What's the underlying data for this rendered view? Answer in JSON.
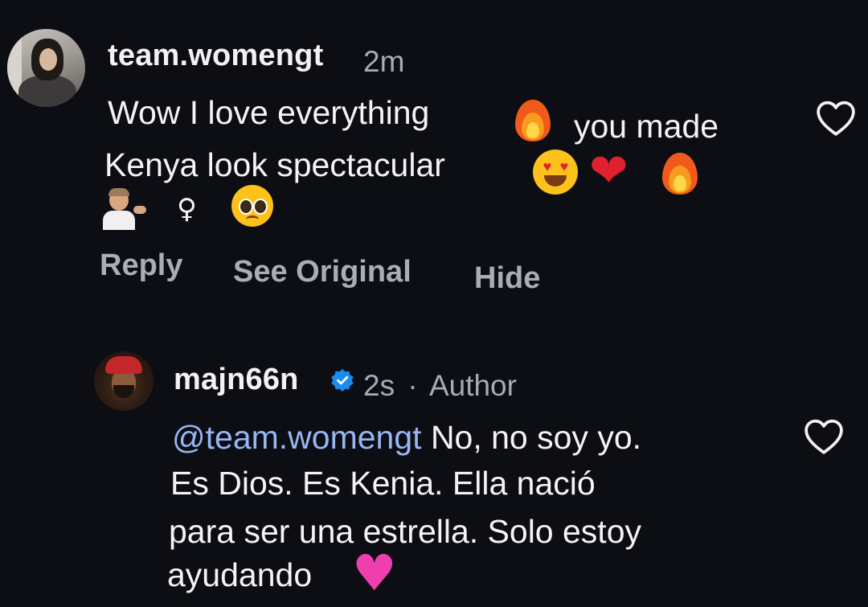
{
  "comments": [
    {
      "username": "team.womengt",
      "time": "2m",
      "text_lines": [
        "Wow I love everything",
        "you made",
        "Kenya look spectacular"
      ],
      "emojis": [
        "fire",
        "smiling-face-with-heart-eyes",
        "red-heart",
        "fire",
        "person-tipping-hand",
        "female-sign",
        "pleading-face"
      ],
      "female_sign_glyph": "♀",
      "actions": {
        "reply": "Reply",
        "see_original": "See Original",
        "hide": "Hide"
      },
      "like_icon": "heart-outline-icon"
    },
    {
      "username": "majn66n",
      "verified": true,
      "time": "2s",
      "separator": "·",
      "badge": "Author",
      "mention": "@team.womengt",
      "text_lines": [
        "No, no soy yo.",
        "Es Dios. Es Kenia. Ella nació",
        "para ser una estrella. Solo estoy",
        "ayudando"
      ],
      "emojis": [
        "pink-heart"
      ],
      "like_icon": "heart-outline-icon"
    }
  ],
  "colors": {
    "background": "#0c0e13",
    "text": "#f4f4f4",
    "secondary": "#a7abb3",
    "mention": "#97b6f3",
    "verified": "#1a8cf0"
  },
  "glyphs": {
    "red_heart": "❤",
    "pink_heart": "♥"
  }
}
